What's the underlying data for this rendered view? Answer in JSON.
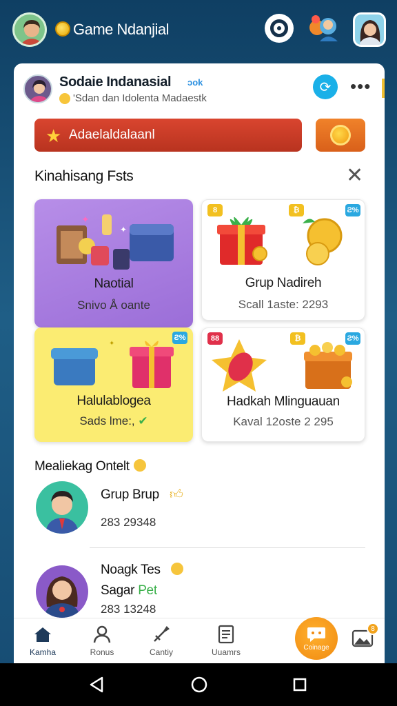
{
  "topbar": {
    "title": "Game Ndanjial"
  },
  "header": {
    "name": "Sodaie Indanasial",
    "tag": "ɔok",
    "subtitle": "'Sdan dan Idolenta Madaestk"
  },
  "banner": {
    "label": "Adaelaldalaanl"
  },
  "section_title": "Kinahisang Fsts",
  "tiles": [
    {
      "title": "Naotial",
      "subtitle": "Snivo Å oante"
    },
    {
      "title": "Grup Nadireh",
      "subtitle": "Scall 1aste: 2293"
    },
    {
      "title": "Halulablogea",
      "subtitle": "Sads lme:,"
    },
    {
      "title": "Hadkah Mlinguauan",
      "subtitle": "Kaval 12oste 2 295"
    }
  ],
  "tile_badges": [
    "8",
    "Ƨ%",
    "88",
    "Ƨ%"
  ],
  "section2_title": "Mealiekag Ontelt",
  "list": [
    {
      "name": "Grup Brup",
      "value": "283 29348"
    },
    {
      "name": "Noagk Tes",
      "name2": "Sagar",
      "tag": "Pet",
      "value": "283 13248"
    }
  ],
  "bottom_nav": [
    {
      "label": "Kamha",
      "icon": "home-icon"
    },
    {
      "label": "Ronus",
      "icon": "people-icon"
    },
    {
      "label": "Cantiy",
      "icon": "sword-icon"
    },
    {
      "label": "Uuamrs",
      "icon": "list-icon"
    },
    {
      "label": "Coinage",
      "icon": "chat-icon"
    }
  ],
  "notification_count": "8",
  "colors": {
    "background": "#164b72",
    "banner": "#c93a24",
    "coin_button": "#e6701f",
    "refresh": "#1ab0e8",
    "tile_purple": "#a47ee0",
    "tile_yellow": "#fbec72",
    "fab": "#f59a18"
  }
}
